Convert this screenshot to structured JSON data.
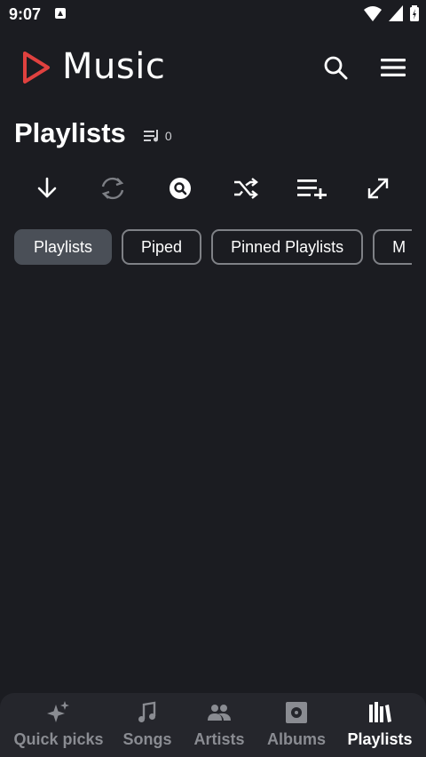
{
  "status_bar": {
    "time": "9:07"
  },
  "app_bar": {
    "title": "Music",
    "logo_color": "#e0413f"
  },
  "header": {
    "title": "Playlists",
    "count": "0"
  },
  "toolbar": {
    "buttons": [
      {
        "icon": "download-icon"
      },
      {
        "icon": "sync-icon"
      },
      {
        "icon": "search-circle-icon"
      },
      {
        "icon": "shuffle-icon"
      },
      {
        "icon": "playlist-add-icon"
      },
      {
        "icon": "expand-icon"
      }
    ]
  },
  "chips": [
    {
      "label": "Playlists",
      "active": true
    },
    {
      "label": "Piped",
      "active": false
    },
    {
      "label": "Pinned Playlists",
      "active": false
    },
    {
      "label": "M",
      "active": false
    }
  ],
  "bottom_nav": [
    {
      "label": "Quick picks",
      "icon": "sparkle-icon",
      "active": false
    },
    {
      "label": "Songs",
      "icon": "music-note-icon",
      "active": false
    },
    {
      "label": "Artists",
      "icon": "people-icon",
      "active": false
    },
    {
      "label": "Albums",
      "icon": "album-icon",
      "active": false
    },
    {
      "label": "Playlists",
      "icon": "library-icon",
      "active": true
    }
  ],
  "colors": {
    "background": "#1b1c21",
    "nav_background": "#25262c",
    "chip_active": "#4a4f57",
    "accent": "#e0413f"
  }
}
